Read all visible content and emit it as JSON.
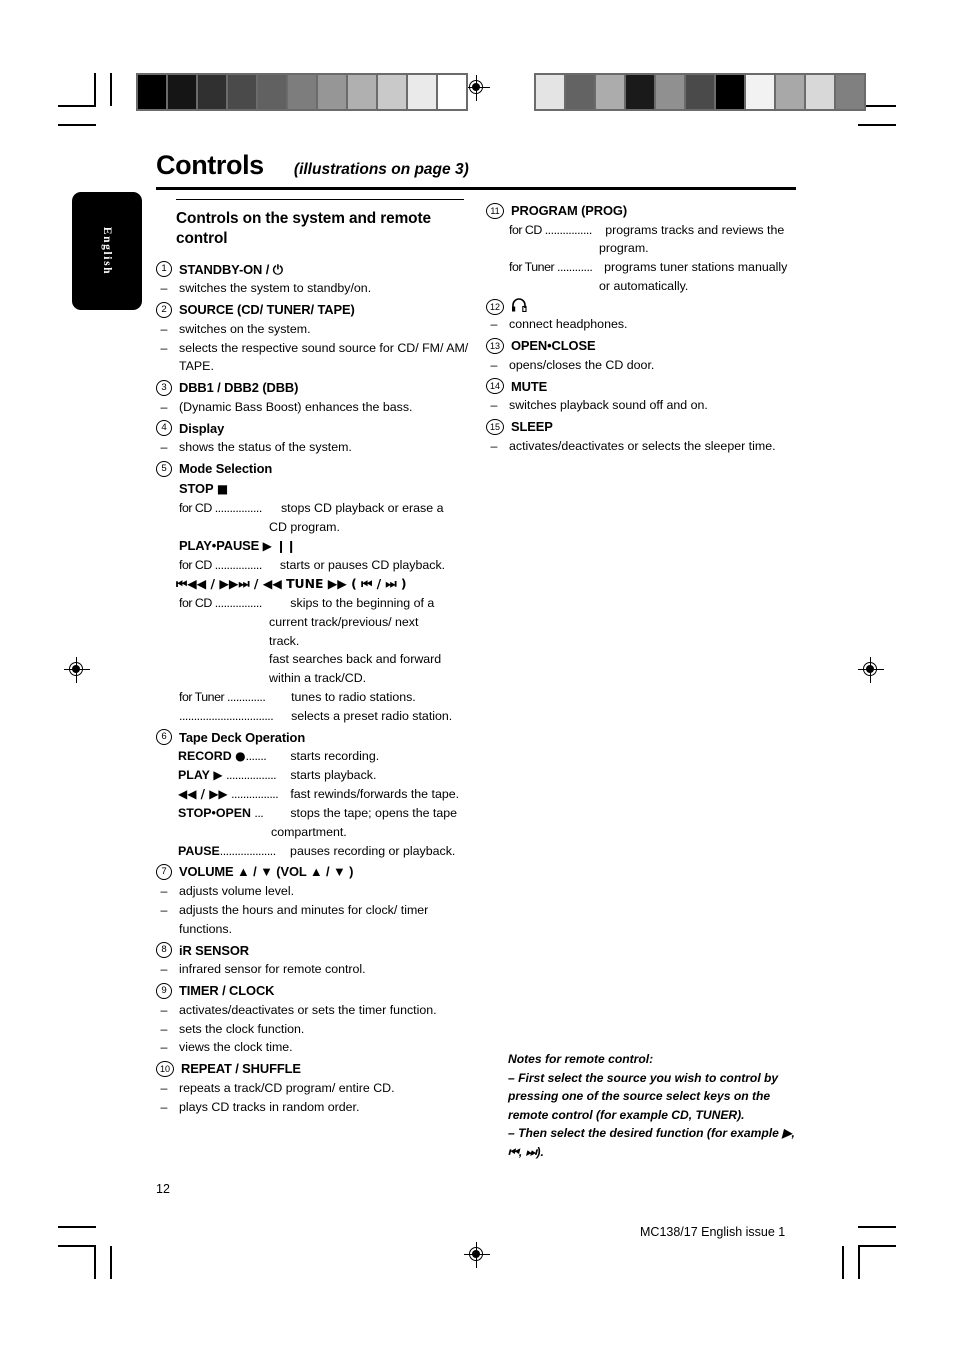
{
  "document": {
    "title": "Controls",
    "title_suffix": "(illustrations on page 3)",
    "language_tab": "English",
    "page_number": "12",
    "footer_right": "MC138/17 English issue 1"
  },
  "left_column": {
    "section_heading": "Controls on the system and remote control",
    "entries": [
      {
        "num": "1",
        "title": "STANDBY-ON / ⏻",
        "dashes": [
          "switches the system to standby/on."
        ]
      },
      {
        "num": "2",
        "title": "SOURCE (CD/ TUNER/ TAPE)",
        "dashes": [
          "switches on the system.",
          "selects the respective sound source for CD/ FM/ AM/  TAPE."
        ]
      },
      {
        "num": "3",
        "title": "DBB1 / DBB2 (DBB)",
        "dashes": [
          "(Dynamic Bass Boost) enhances the bass."
        ]
      },
      {
        "num": "4",
        "title": "Display",
        "dashes": [
          "shows the status of the system."
        ]
      },
      {
        "num": "5",
        "title": "Mode Selection",
        "subs": [
          {
            "label": "STOP",
            "symbol": "■",
            "defs": [
              {
                "key": "for CD ................",
                "val": "stops CD playback or erase a"
              }
            ],
            "cont": [
              "CD program."
            ]
          },
          {
            "label": "PLAY•PAUSE",
            "symbol": "▶ ❙❙",
            "defs": [
              {
                "key": "for CD ................",
                "val": "starts or pauses CD playback."
              }
            ],
            "cont": []
          },
          {
            "label": "",
            "symbol": "⏮◀◀ / ▶▶⏭  /  ◀◀ TUNE ▶▶   ( ⏮ / ⏭ )",
            "defs": [
              {
                "key": "for CD ................",
                "val": "skips to the beginning of a"
              }
            ],
            "cont": [
              "current track/previous/ next",
              "track.",
              "fast searches back and forward",
              "within a track/CD."
            ],
            "defs2": [
              {
                "key": "for Tuner .............",
                "val": "tunes to radio stations."
              },
              {
                "key": "................................",
                "val": "selects a preset radio station."
              }
            ]
          }
        ]
      },
      {
        "num": "6",
        "title": "Tape Deck Operation",
        "tape": [
          {
            "label": "RECORD",
            "symbol": "●",
            "dots": ".......",
            "val": "starts recording."
          },
          {
            "label": "PLAY",
            "symbol": "▶",
            "dots": ".................",
            "val": "starts playback."
          },
          {
            "label": "",
            "symbol": "◀◀ / ▶▶",
            "dots": "................",
            "val": "fast rewinds/forwards the tape."
          },
          {
            "label": "STOP•OPEN",
            "symbol": "",
            "dots": "...",
            "val": "stops the tape; opens the tape"
          }
        ],
        "tape_cont": "compartment.",
        "tape_last": {
          "label": "PAUSE",
          "dots": "...................",
          "val": "pauses recording or playback."
        }
      },
      {
        "num": "7",
        "title": "VOLUME ▲ / ▼ (VOL ▲ / ▼ )",
        "dashes": [
          "adjusts volume level.",
          "adjusts the hours and minutes for clock/ timer functions."
        ]
      },
      {
        "num": "8",
        "title": "iR SENSOR",
        "dashes": [
          "infrared sensor for remote control."
        ]
      },
      {
        "num": "9",
        "title": "TIMER / CLOCK",
        "dashes": [
          "activates/deactivates or sets the timer function.",
          "sets the clock function.",
          "views the clock time."
        ]
      },
      {
        "num": "10",
        "title": "REPEAT / SHUFFLE",
        "dashes": [
          "repeats a track/CD program/ entire CD.",
          "plays CD tracks in random order."
        ]
      }
    ]
  },
  "right_column": {
    "entries": [
      {
        "num": "11",
        "title": "PROGRAM (PROG)",
        "defs": [
          {
            "key": "for CD ................",
            "val": "programs tracks and reviews the"
          },
          {
            "cont": "program."
          },
          {
            "key": "for Tuner ............",
            "val": "programs tuner stations manually"
          },
          {
            "cont": "or automatically."
          }
        ]
      },
      {
        "num": "12",
        "title_icon": "headphones-icon",
        "title": "∩",
        "dashes": [
          "connect headphones."
        ]
      },
      {
        "num": "13",
        "title": "OPEN•CLOSE",
        "dashes": [
          "opens/closes the CD door."
        ]
      },
      {
        "num": "14",
        "title": "MUTE",
        "dashes": [
          "switches playback sound off and on."
        ]
      },
      {
        "num": "15",
        "title": "SLEEP",
        "dashes": [
          "activates/deactivates or selects the sleeper time."
        ]
      }
    ],
    "notes": {
      "heading": "Notes for remote control:",
      "lines": [
        "–  First select the source you wish to control by pressing one of the source select keys on the remote control (for example CD, TUNER).",
        "–  Then select the desired function (for example ▶,  ⏮,  ⏭)."
      ]
    }
  },
  "print_marks": {
    "step_wedge_left": [
      "#000000",
      "#151515",
      "#303030",
      "#4a4a4a",
      "#616161",
      "#7d7d7d",
      "#969696",
      "#b0b0b0",
      "#c9c9c9",
      "#eaeaea",
      "#ffffff"
    ],
    "step_wedge_right": [
      "#e4e4e4",
      "#636363",
      "#acacac",
      "#1a1a1a",
      "#909090",
      "#4a4a4a",
      "#000000",
      "#f2f2f2",
      "#a8a8a8",
      "#d8d8d8",
      "#808080"
    ]
  }
}
